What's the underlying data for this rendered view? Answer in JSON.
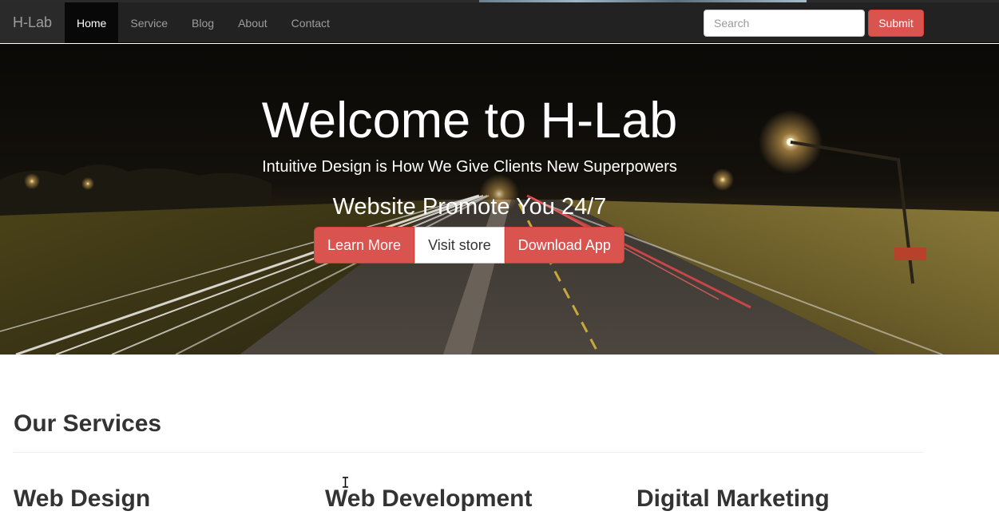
{
  "navbar": {
    "brand": "H-Lab",
    "items": [
      {
        "label": "Home",
        "active": true
      },
      {
        "label": "Service",
        "active": false
      },
      {
        "label": "Blog",
        "active": false
      },
      {
        "label": "About",
        "active": false
      },
      {
        "label": "Contact",
        "active": false
      }
    ],
    "search": {
      "placeholder": "Search",
      "value": ""
    },
    "submit_label": "Submit"
  },
  "hero": {
    "title": "Welcome to H-Lab",
    "subtitle": "Intuitive Design is How We Give Clients New Superpowers",
    "promo": "Website Promote You 24/7",
    "buttons": [
      {
        "label": "Learn More",
        "style": "danger"
      },
      {
        "label": "Visit store",
        "style": "default"
      },
      {
        "label": "Download App",
        "style": "danger"
      }
    ],
    "background": "night highway with light trails"
  },
  "services": {
    "title": "Our Services",
    "items": [
      {
        "heading": "Web Design"
      },
      {
        "heading": "Web Development"
      },
      {
        "heading": "Digital Marketing"
      }
    ]
  },
  "colors": {
    "navbar_bg": "#222222",
    "accent_danger": "#d9534f",
    "text_dark": "#333333"
  }
}
